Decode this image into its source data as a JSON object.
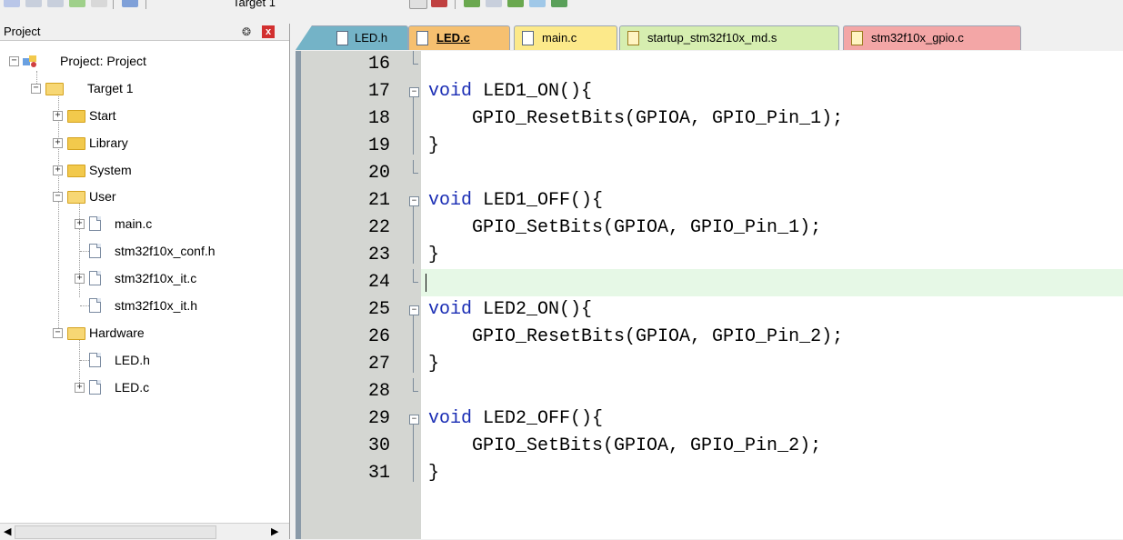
{
  "toolbar": {
    "target": "Target 1"
  },
  "project_pane": {
    "title": "Project",
    "pin_glyph": "❂",
    "close_glyph": "x",
    "tree": {
      "root": "Project: Project",
      "target": "Target 1",
      "groups": [
        "Start",
        "Library",
        "System",
        "User",
        "Hardware"
      ],
      "user_files": [
        "main.c",
        "stm32f10x_conf.h",
        "stm32f10x_it.c",
        "stm32f10x_it.h"
      ],
      "hardware_files": [
        "LED.h",
        "LED.c"
      ]
    }
  },
  "tabs": [
    {
      "label": "LED.h",
      "icon": "file-icon"
    },
    {
      "label": "LED.c",
      "icon": "file-icon",
      "active": true
    },
    {
      "label": "main.c",
      "icon": "file-icon"
    },
    {
      "label": "startup_stm32f10x_md.s",
      "icon": "key-file-icon"
    },
    {
      "label": "stm32f10x_gpio.c",
      "icon": "key-file-icon"
    }
  ],
  "editor": {
    "current_line": 24,
    "lines": [
      {
        "n": "16",
        "kw": "",
        "text": ""
      },
      {
        "n": "17",
        "kw": "void",
        "text": " LED1_ON(){"
      },
      {
        "n": "18",
        "kw": "",
        "text": "    GPIO_ResetBits(GPIOA, GPIO_Pin_1);"
      },
      {
        "n": "19",
        "kw": "",
        "text": "}"
      },
      {
        "n": "20",
        "kw": "",
        "text": ""
      },
      {
        "n": "21",
        "kw": "void",
        "text": " LED1_OFF(){"
      },
      {
        "n": "22",
        "kw": "",
        "text": "    GPIO_SetBits(GPIOA, GPIO_Pin_1);"
      },
      {
        "n": "23",
        "kw": "",
        "text": "}"
      },
      {
        "n": "24",
        "kw": "",
        "text": ""
      },
      {
        "n": "25",
        "kw": "void",
        "text": " LED2_ON(){"
      },
      {
        "n": "26",
        "kw": "",
        "text": "    GPIO_ResetBits(GPIOA, GPIO_Pin_2);"
      },
      {
        "n": "27",
        "kw": "",
        "text": "}"
      },
      {
        "n": "28",
        "kw": "",
        "text": ""
      },
      {
        "n": "29",
        "kw": "void",
        "text": " LED2_OFF(){"
      },
      {
        "n": "30",
        "kw": "",
        "text": "    GPIO_SetBits(GPIOA, GPIO_Pin_2);"
      },
      {
        "n": "31",
        "kw": "",
        "text": "}"
      }
    ]
  },
  "colors": {
    "keyword": "#1a2db4",
    "current_line_bg": "#e6f8e6",
    "tab_led_h": "#74b3c7",
    "tab_led_c": "#f6c070",
    "tab_main_c": "#fce98a",
    "tab_startup": "#d6eeb0",
    "tab_gpio": "#f3a6a6"
  }
}
